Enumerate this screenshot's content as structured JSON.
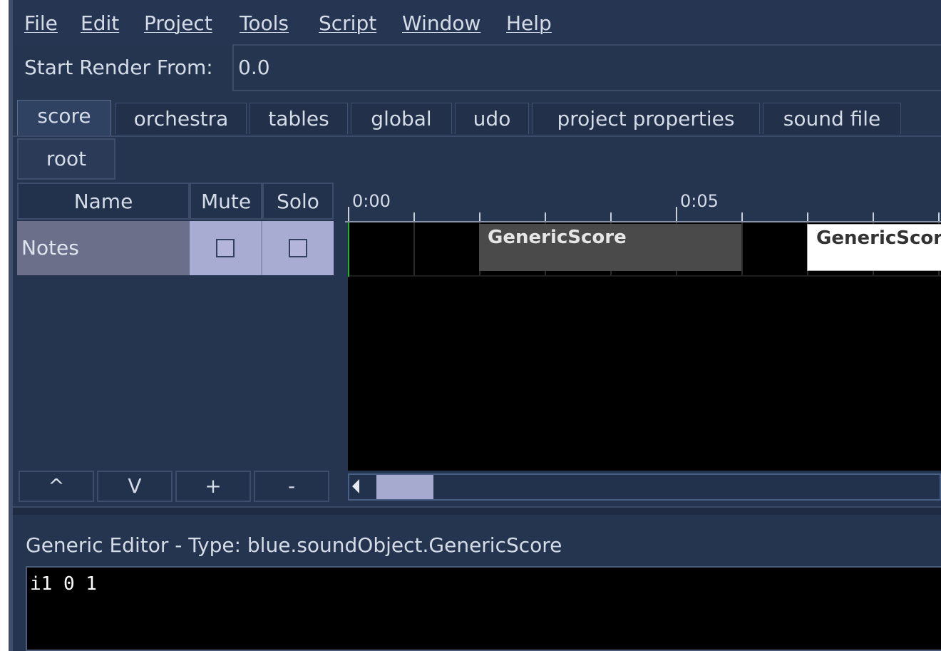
{
  "menu": {
    "items": [
      "File",
      "Edit",
      "Project",
      "Tools",
      "Script",
      "Window",
      "Help"
    ]
  },
  "render": {
    "label": "Start Render From:",
    "value": "0.0"
  },
  "tabs": [
    "score",
    "orchestra",
    "tables",
    "global",
    "udo",
    "project properties",
    "sound file"
  ],
  "active_tab": "score",
  "breadcrumb": {
    "root": "root"
  },
  "track_table": {
    "headers": {
      "name": "Name",
      "mute": "Mute",
      "solo": "Solo"
    },
    "rows": [
      {
        "name": "Notes",
        "mute": false,
        "solo": false
      }
    ],
    "buttons": {
      "up": "^",
      "down": "V",
      "add": "+",
      "remove": "-"
    }
  },
  "timeline": {
    "ruler_labels": [
      "0:00",
      "0:05"
    ],
    "sound_objects": [
      {
        "label": "GenericScore",
        "selected": false
      },
      {
        "label": "GenericScore",
        "selected": true
      }
    ]
  },
  "editor": {
    "title": "Generic Editor - Type: blue.soundObject.GenericScore",
    "content": "i1 0 1"
  },
  "colors": {
    "panel": "#25344f",
    "selected_row": "#a9acd2",
    "playhead": "#22b522"
  }
}
